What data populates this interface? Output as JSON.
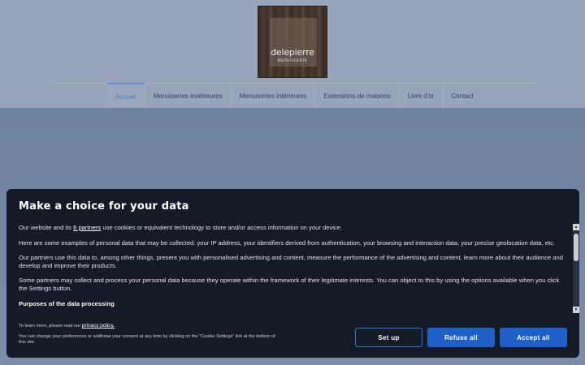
{
  "logo": {
    "name": "delepierre",
    "subtitle": "MENUISERIE"
  },
  "nav": {
    "items": [
      {
        "label": "Accueil"
      },
      {
        "label": "Menuiseries extérieures"
      },
      {
        "label": "Menuiseries intérieures"
      },
      {
        "label": "Extensions de maisons"
      },
      {
        "label": "Livre d'or"
      },
      {
        "label": "Contact"
      }
    ]
  },
  "consent": {
    "title": "Make a choice for your data",
    "intro_before": "Our website and its ",
    "partners_link": "6 partners",
    "intro_after": " use cookies or equivalent technology to store and/or access information on your device.",
    "paragraph2": "Here are some examples of personal data that may be collected: your IP address, your identifiers derived from authentication, your browsing and interaction data, your precise geolocation data, etc.",
    "paragraph3": "Our partners use this data to, among other things, present you with personalised advertising and content, measure the performance of the advertising and content, learn more about their audience and develop and improve their products.",
    "paragraph4": "Some partners may collect and process your personal data because they operate within the framework of their legitimate interests. You can object to this by using the options available when you click the Settings button.",
    "purposes_heading": "Purposes of the data processing",
    "learn_more": "To learn more, please read our ",
    "privacy_link": "privacy policy.",
    "change_text": "You can change your preferences or widthraw your consent at any time by clicking on the \"Cookie Settings\" link at the bottom of this site.",
    "buttons": {
      "setup": "Set up",
      "refuse": "Refuse all",
      "accept": "Accept all"
    }
  },
  "colors": {
    "modal_bg": "#141a26",
    "button_blue": "#1f5fc8",
    "nav_active": "#4a7fc1"
  }
}
